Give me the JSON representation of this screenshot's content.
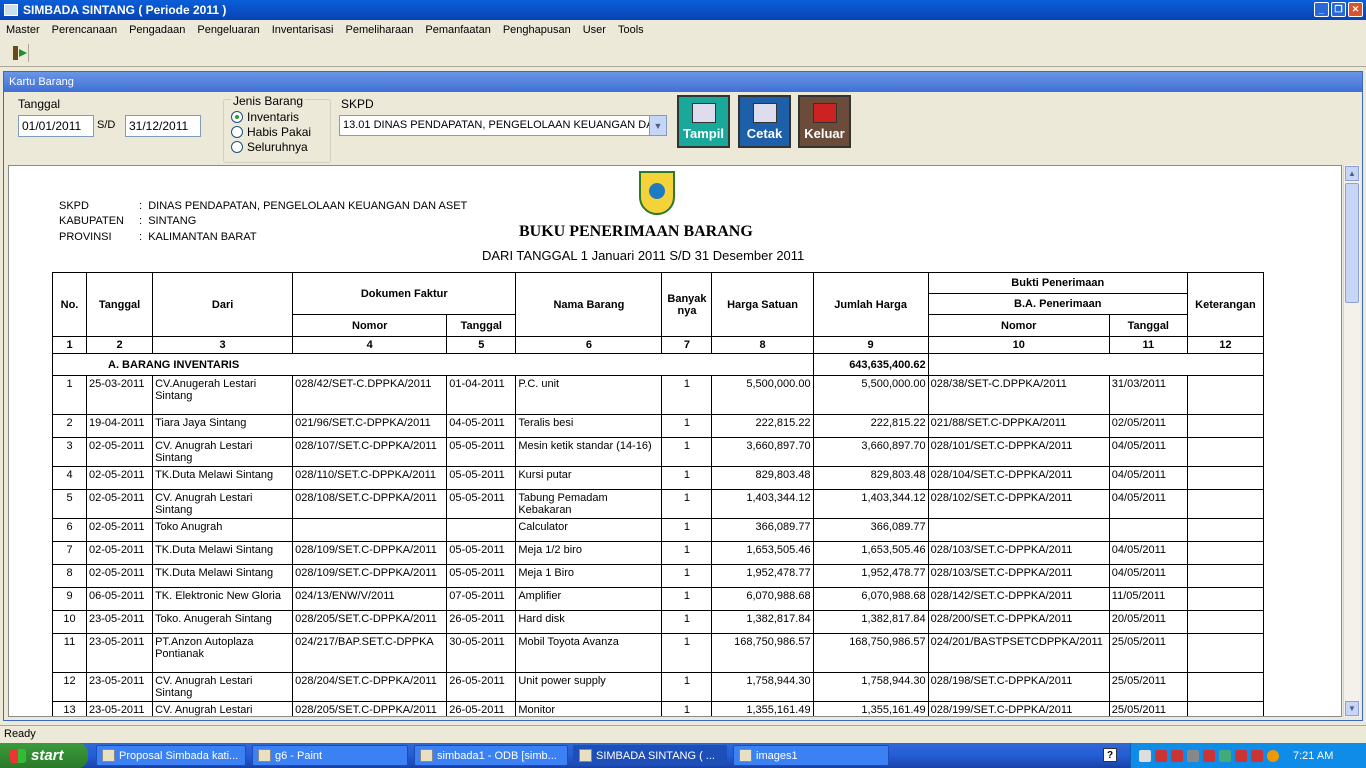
{
  "window": {
    "title": "SIMBADA SINTANG ( Periode 2011 )",
    "btn_min": "_",
    "btn_max": "❐",
    "btn_close": "✕"
  },
  "menu": [
    "Master",
    "Perencanaan",
    "Pengadaan",
    "Pengeluaran",
    "Inventarisasi",
    "Pemeliharaan",
    "Pemanfaatan",
    "Penghapusan",
    "User",
    "Tools"
  ],
  "form": {
    "title": "Kartu Barang",
    "tanggal_label": "Tanggal",
    "date_from": "01/01/2011",
    "sd_label": "S/D",
    "date_to": "31/12/2011",
    "jenis_label": "Jenis Barang",
    "radio_inventaris": "Inventaris",
    "radio_habis": "Habis Pakai",
    "radio_semua": "Seluruhnya",
    "skpd_label": "SKPD",
    "skpd_value": "13.01 DINAS PENDAPATAN, PENGELOLAAN KEUANGAN DA",
    "btn_tampil": "Tampil",
    "btn_cetak": "Cetak",
    "btn_keluar": "Keluar"
  },
  "report": {
    "skpd_key": "SKPD",
    "skpd_val": "DINAS PENDAPATAN, PENGELOLAAN KEUANGAN DAN ASET",
    "kab_key": "KABUPATEN",
    "kab_val": "SINTANG",
    "prov_key": "PROVINSI",
    "prov_val": "KALIMANTAN BARAT",
    "colon": ":",
    "title": "BUKU PENERIMAAN BARANG",
    "subtitle": "DARI TANGGAL 1 Januari 2011 S/D 31 Desember 2011",
    "h_no": "No.",
    "h_tanggal": "Tanggal",
    "h_dari": "Dari",
    "h_dok": "Dokumen Faktur",
    "h_nomor": "Nomor",
    "h_tgl": "Tanggal",
    "h_nama": "Nama Barang",
    "h_banyak": "Banyak nya",
    "h_harga": "Harga Satuan",
    "h_jumlah": "Jumlah Harga",
    "h_bukti": "Bukti Penerimaan",
    "h_ba": "B.A. Penerimaan",
    "h_bnomor": "Nomor",
    "h_btgl": "Tanggal",
    "h_ket": "Keterangan",
    "colnums": [
      "1",
      "2",
      "3",
      "4",
      "5",
      "6",
      "7",
      "8",
      "9",
      "10",
      "11",
      "12"
    ],
    "section_label": "A. BARANG INVENTARIS",
    "section_total": "643,635,400.62",
    "rows": [
      [
        "1",
        "25-03-2011",
        "CV.Anugerah Lestari Sintang",
        "028/42/SET-C.DPPKA/2011",
        "01-04-2011",
        "P.C. unit",
        "1",
        "5,500,000.00",
        "5,500,000.00",
        "028/38/SET-C.DPPKA/2011",
        "31/03/2011"
      ],
      [
        "2",
        "19-04-2011",
        "Tiara Jaya Sintang",
        "021/96/SET.C-DPPKA/2011",
        "04-05-2011",
        "Teralis besi",
        "1",
        "222,815.22",
        "222,815.22",
        "021/88/SET.C-DPPKA/2011",
        "02/05/2011"
      ],
      [
        "3",
        "02-05-2011",
        "CV. Anugrah Lestari Sintang",
        "028/107/SET.C-DPPKA/2011",
        "05-05-2011",
        "Mesin ketik standar (14-16)",
        "1",
        "3,660,897.70",
        "3,660,897.70",
        "028/101/SET.C-DPPKA/2011",
        "04/05/2011"
      ],
      [
        "4",
        "02-05-2011",
        "TK.Duta Melawi Sintang",
        "028/110/SET.C-DPPKA/2011",
        "05-05-2011",
        "Kursi putar",
        "1",
        "829,803.48",
        "829,803.48",
        "028/104/SET.C-DPPKA/2011",
        "04/05/2011"
      ],
      [
        "5",
        "02-05-2011",
        "CV. Anugrah Lestari Sintang",
        "028/108/SET.C-DPPKA/2011",
        "05-05-2011",
        "Tabung Pemadam Kebakaran",
        "1",
        "1,403,344.12",
        "1,403,344.12",
        "028/102/SET.C-DPPKA/2011",
        "04/05/2011"
      ],
      [
        "6",
        "02-05-2011",
        "Toko Anugrah",
        "",
        "",
        "Calculator",
        "1",
        "366,089.77",
        "366,089.77",
        "",
        ""
      ],
      [
        "7",
        "02-05-2011",
        "TK.Duta Melawi Sintang",
        "028/109/SET.C-DPPKA/2011",
        "05-05-2011",
        "Meja 1/2 biro",
        "1",
        "1,653,505.46",
        "1,653,505.46",
        "028/103/SET.C-DPPKA/2011",
        "04/05/2011"
      ],
      [
        "8",
        "02-05-2011",
        "TK.Duta Melawi Sintang",
        "028/109/SET.C-DPPKA/2011",
        "05-05-2011",
        "Meja 1 Biro",
        "1",
        "1,952,478.77",
        "1,952,478.77",
        "028/103/SET.C-DPPKA/2011",
        "04/05/2011"
      ],
      [
        "9",
        "06-05-2011",
        "TK. Elektronic New Gloria",
        "024/13/ENW/V/2011",
        "07-05-2011",
        "Amplifier",
        "1",
        "6,070,988.68",
        "6,070,988.68",
        "028/142/SET.C-DPPKA/2011",
        "11/05/2011"
      ],
      [
        "10",
        "23-05-2011",
        "Toko. Anugerah Sintang",
        "028/205/SET.C-DPPKA/2011",
        "26-05-2011",
        "Hard disk",
        "1",
        "1,382,817.84",
        "1,382,817.84",
        "028/200/SET.C-DPPKA/2011",
        "20/05/2011"
      ],
      [
        "11",
        "23-05-2011",
        "PT.Anzon Autoplaza Pontianak",
        "024/217/BAP.SET.C-DPPKA",
        "30-05-2011",
        "Mobil Toyota Avanza",
        "1",
        "168,750,986.57",
        "168,750,986.57",
        "024/201/BASTPSETCDPPKA/2011",
        "25/05/2011"
      ],
      [
        "12",
        "23-05-2011",
        "CV. Anugrah Lestari Sintang",
        "028/204/SET.C-DPPKA/2011",
        "26-05-2011",
        "Unit power supply",
        "1",
        "1,758,944.30",
        "1,758,944.30",
        "028/198/SET.C-DPPKA/2011",
        "25/05/2011"
      ],
      [
        "13",
        "23-05-2011",
        "CV. Anugrah Lestari Sintang",
        "028/205/SET.C-DPPKA/2011",
        "26-05-2011",
        "Monitor",
        "1",
        "1,355,161.49",
        "1,355,161.49",
        "028/199/SET.C-DPPKA/2011",
        "25/05/2011"
      ]
    ]
  },
  "status": {
    "text": "Ready"
  },
  "taskbar": {
    "start": "start",
    "tasks": [
      "Proposal Simbada kati...",
      "g6 - Paint",
      "simbada1 - ODB [simb...",
      "SIMBADA SINTANG ( ...",
      "images1"
    ],
    "help": "?",
    "clock": "7:21 AM"
  },
  "colors": {
    "titlebar": "#0a5fd8",
    "btn_tampil": "#1aa89a",
    "btn_cetak": "#1d5fa8",
    "btn_keluar": "#6b4b3a"
  }
}
